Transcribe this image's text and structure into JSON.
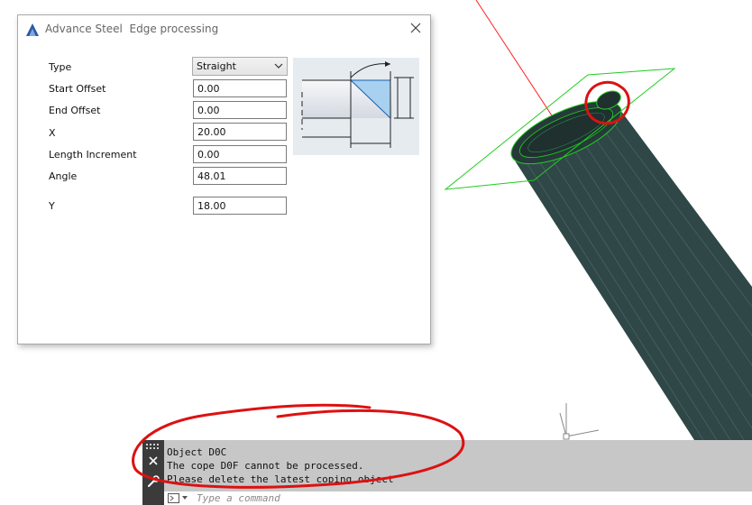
{
  "dialog": {
    "app_name": "Advance Steel",
    "title": "Edge processing",
    "fields": {
      "type": {
        "label": "Type",
        "value": "Straight"
      },
      "start_offset": {
        "label": "Start Offset",
        "value": "0.00"
      },
      "end_offset": {
        "label": "End Offset",
        "value": "0.00"
      },
      "x": {
        "label": "X",
        "value": "20.00"
      },
      "length_increment": {
        "label": "Length Increment",
        "value": "0.00"
      },
      "angle": {
        "label": "Angle",
        "value": "48.01"
      },
      "y": {
        "label": "Y",
        "value": "18.00"
      }
    },
    "icons": [
      "advance-steel-logo-icon",
      "close-icon",
      "chevron-down-icon"
    ]
  },
  "command_line": {
    "history": [
      "Object D0C",
      "The cope D0F cannot be processed.",
      "Please delete the latest coping object"
    ],
    "input_placeholder": "Type a command",
    "icons": [
      "grip-icon",
      "close-icon",
      "wrench-icon",
      "command-prompt-icon"
    ]
  },
  "colors": {
    "member": "#2f4847",
    "plane": "#22cc22",
    "annotation": "#dd1111",
    "command_bg": "#c7c7c7",
    "command_sidebar": "#3b3b3b"
  }
}
